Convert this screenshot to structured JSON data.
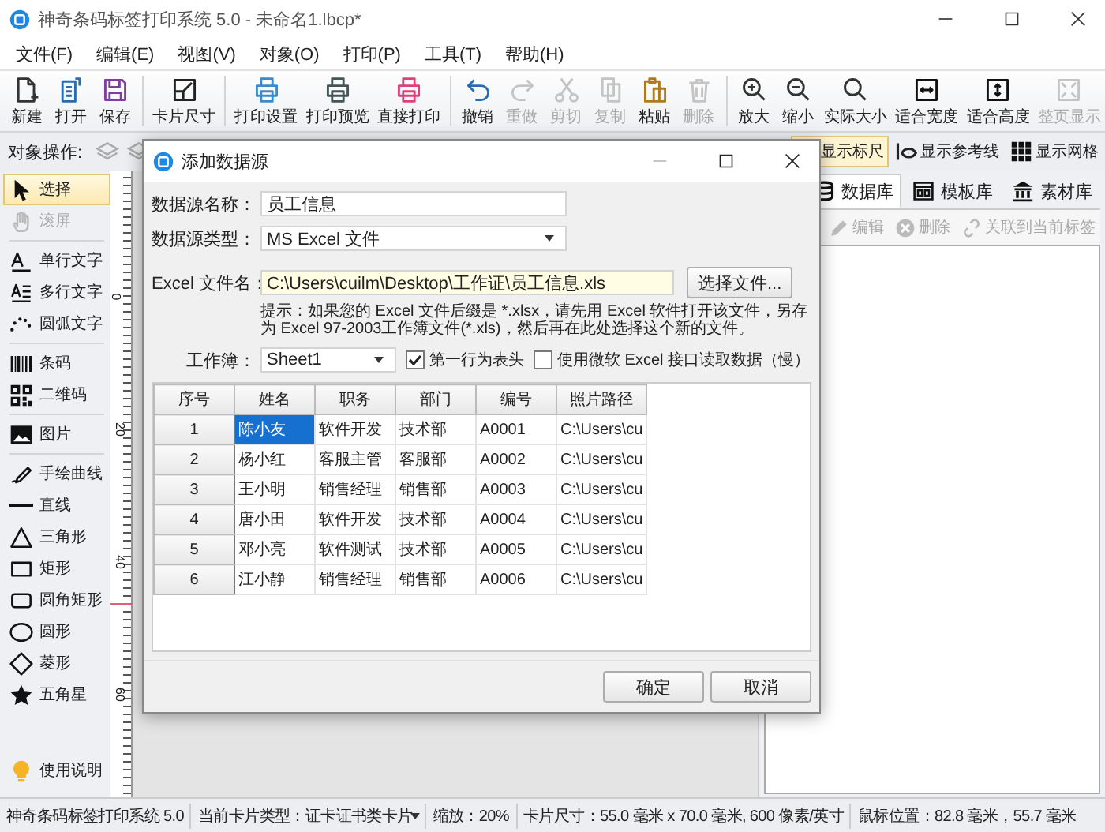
{
  "app_window": {
    "title": "神奇条码标签打印系统 5.0 - 未命名1.lbcp*"
  },
  "menu": [
    "文件(F)",
    "编辑(E)",
    "视图(V)",
    "对象(O)",
    "打印(P)",
    "工具(T)",
    "帮助(H)"
  ],
  "toolbar_groups": [
    {
      "buttons": [
        {
          "label": "新建",
          "disabled": false
        },
        {
          "label": "打开",
          "disabled": false
        },
        {
          "label": "保存",
          "disabled": false
        }
      ]
    },
    {
      "buttons": [
        {
          "label": "卡片尺寸",
          "disabled": false
        }
      ]
    },
    {
      "buttons": [
        {
          "label": "打印设置",
          "disabled": false
        },
        {
          "label": "打印预览",
          "disabled": false
        },
        {
          "label": "直接打印",
          "disabled": false
        }
      ]
    },
    {
      "buttons": [
        {
          "label": "撤销",
          "disabled": false
        },
        {
          "label": "重做",
          "disabled": true
        },
        {
          "label": "剪切",
          "disabled": true
        },
        {
          "label": "复制",
          "disabled": true
        },
        {
          "label": "粘贴",
          "disabled": false
        },
        {
          "label": "删除",
          "disabled": true
        }
      ]
    },
    {
      "buttons": [
        {
          "label": "放大",
          "disabled": false
        },
        {
          "label": "缩小",
          "disabled": false
        },
        {
          "label": "实际大小",
          "disabled": false
        },
        {
          "label": "适合宽度",
          "disabled": false
        },
        {
          "label": "适合高度",
          "disabled": false
        },
        {
          "label": "整页显示",
          "disabled": true
        }
      ]
    }
  ],
  "object_bar": {
    "label": "对象操作:"
  },
  "view_toggles": [
    {
      "label": "显示标尺",
      "selected": true
    },
    {
      "label": "显示参考线",
      "selected": false
    },
    {
      "label": "显示网格",
      "selected": false
    }
  ],
  "tool_groups": [
    {
      "tools": [
        {
          "label": "选择",
          "selected": true,
          "disabled": false
        },
        {
          "label": "滚屏",
          "selected": false,
          "disabled": true
        }
      ]
    },
    {
      "tools": [
        {
          "label": "单行文字",
          "selected": false,
          "disabled": false
        },
        {
          "label": "多行文字",
          "selected": false,
          "disabled": false
        },
        {
          "label": "圆弧文字",
          "selected": false,
          "disabled": false
        }
      ]
    },
    {
      "tools": [
        {
          "label": "条码",
          "selected": false,
          "disabled": false
        },
        {
          "label": "二维码",
          "selected": false,
          "disabled": false
        }
      ]
    },
    {
      "tools": [
        {
          "label": "图片",
          "selected": false,
          "disabled": false
        }
      ]
    },
    {
      "tools": [
        {
          "label": "手绘曲线",
          "selected": false,
          "disabled": false
        },
        {
          "label": "直线",
          "selected": false,
          "disabled": false
        },
        {
          "label": "三角形",
          "selected": false,
          "disabled": false
        },
        {
          "label": "矩形",
          "selected": false,
          "disabled": false
        },
        {
          "label": "圆角矩形",
          "selected": false,
          "disabled": false
        },
        {
          "label": "圆形",
          "selected": false,
          "disabled": false
        },
        {
          "label": "菱形",
          "selected": false,
          "disabled": false
        },
        {
          "label": "五角星",
          "selected": false,
          "disabled": false
        }
      ]
    }
  ],
  "help_button": {
    "label": "使用说明"
  },
  "ruler": {
    "labels": [
      "0",
      "20",
      "40",
      "60"
    ]
  },
  "right_panel": {
    "tabs": [
      {
        "label": "数据库",
        "selected": true
      },
      {
        "label": "模板库",
        "selected": false
      },
      {
        "label": "素材库",
        "selected": false
      }
    ],
    "actions": [
      {
        "label": "编辑",
        "disabled": true
      },
      {
        "label": "删除",
        "disabled": true
      },
      {
        "label": "关联到当前标签",
        "disabled": true
      }
    ]
  },
  "dialog": {
    "title": "添加数据源",
    "name_label": "数据源名称：",
    "name_value": "员工信息",
    "type_label": "数据源类型：",
    "type_value": "MS Excel 文件",
    "file_label": "Excel 文件名：",
    "file_value": "C:\\Users\\cuilm\\Desktop\\工作证\\员工信息.xls",
    "browse_button": "选择文件...",
    "hint": "提示：如果您的 Excel 文件后缀是 *.xlsx，请先用 Excel 软件打开该文件，另存为 Excel 97-2003工作簿文件(*.xls)，然后再在此处选择这个新的文件。",
    "sheet_label": "工作簿：",
    "sheet_value": "Sheet1",
    "options": [
      {
        "label": "第一行为表头",
        "checked": true
      },
      {
        "label": "使用微软 Excel 接口读取数据（慢）",
        "checked": false
      }
    ],
    "table": {
      "columns": [
        "序号",
        "姓名",
        "职务",
        "部门",
        "编号",
        "照片路径"
      ],
      "rows": [
        {
          "cells": [
            {
              "text": "1",
              "selected": false
            },
            {
              "text": "陈小友",
              "selected": true
            },
            {
              "text": "软件开发",
              "selected": false
            },
            {
              "text": "技术部",
              "selected": false
            },
            {
              "text": "A0001",
              "selected": false
            },
            {
              "text": "C:\\Users\\cu",
              "selected": false
            }
          ]
        },
        {
          "cells": [
            {
              "text": "2",
              "selected": false
            },
            {
              "text": "杨小红",
              "selected": false
            },
            {
              "text": "客服主管",
              "selected": false
            },
            {
              "text": "客服部",
              "selected": false
            },
            {
              "text": "A0002",
              "selected": false
            },
            {
              "text": "C:\\Users\\cu",
              "selected": false
            }
          ]
        },
        {
          "cells": [
            {
              "text": "3",
              "selected": false
            },
            {
              "text": "王小明",
              "selected": false
            },
            {
              "text": "销售经理",
              "selected": false
            },
            {
              "text": "销售部",
              "selected": false
            },
            {
              "text": "A0003",
              "selected": false
            },
            {
              "text": "C:\\Users\\cu",
              "selected": false
            }
          ]
        },
        {
          "cells": [
            {
              "text": "4",
              "selected": false
            },
            {
              "text": "唐小田",
              "selected": false
            },
            {
              "text": "软件开发",
              "selected": false
            },
            {
              "text": "技术部",
              "selected": false
            },
            {
              "text": "A0004",
              "selected": false
            },
            {
              "text": "C:\\Users\\cu",
              "selected": false
            }
          ]
        },
        {
          "cells": [
            {
              "text": "5",
              "selected": false
            },
            {
              "text": "邓小亮",
              "selected": false
            },
            {
              "text": "软件测试",
              "selected": false
            },
            {
              "text": "技术部",
              "selected": false
            },
            {
              "text": "A0005",
              "selected": false
            },
            {
              "text": "C:\\Users\\cu",
              "selected": false
            }
          ]
        },
        {
          "cells": [
            {
              "text": "6",
              "selected": false
            },
            {
              "text": "江小静",
              "selected": false
            },
            {
              "text": "销售经理",
              "selected": false
            },
            {
              "text": "销售部",
              "selected": false
            },
            {
              "text": "A0006",
              "selected": false
            },
            {
              "text": "C:\\Users\\cu",
              "selected": false
            }
          ]
        }
      ]
    },
    "buttons": [
      "确定",
      "取消"
    ]
  },
  "status_bar": [
    {
      "text": "神奇条码标签打印系统 5.0",
      "dropdown": false
    },
    {
      "text": "当前卡片类型：证卡证书类卡片",
      "dropdown": true
    },
    {
      "text": "缩放：20%",
      "dropdown": false
    },
    {
      "text": "卡片尺寸：55.0 毫米 x 70.0 毫米, 600 像素/英寸",
      "dropdown": false
    },
    {
      "text": "鼠标位置：82.8 毫米，55.7 毫米",
      "dropdown": false
    }
  ]
}
